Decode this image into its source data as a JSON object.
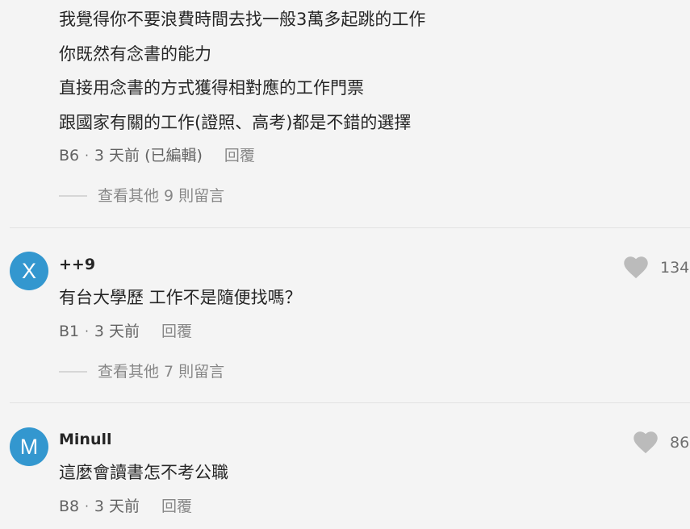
{
  "colors": {
    "background": "#f4f4f4",
    "avatar": "#3397cf",
    "heart": "#bbbbbb",
    "divider": "#e2e2e2"
  },
  "top_comment": {
    "lines": [
      "我覺得你不要浪費時間去找一般3萬多起跳的工作",
      "你既然有念書的能力",
      "直接用念書的方式獲得相對應的工作門票",
      "跟國家有關的工作(證照、高考)都是不錯的選擇"
    ],
    "floor": "B6",
    "time": "3 天前 (已編輯)",
    "reply_label": "回覆",
    "more_replies": "查看其他 9 則留言"
  },
  "comments": [
    {
      "avatar_letter": "X",
      "name": "++9",
      "likes": "134",
      "text": "有台大學歷 工作不是隨便找嗎？",
      "floor": "B1",
      "time": "3 天前",
      "reply_label": "回覆",
      "more_replies": "查看其他 7 則留言"
    },
    {
      "avatar_letter": "M",
      "name": "Minull",
      "likes": "86",
      "text": "這麼會讀書怎不考公職",
      "floor": "B8",
      "time": "3 天前",
      "reply_label": "回覆"
    }
  ],
  "separator": "·",
  "icons": {
    "like": "heart-icon"
  }
}
